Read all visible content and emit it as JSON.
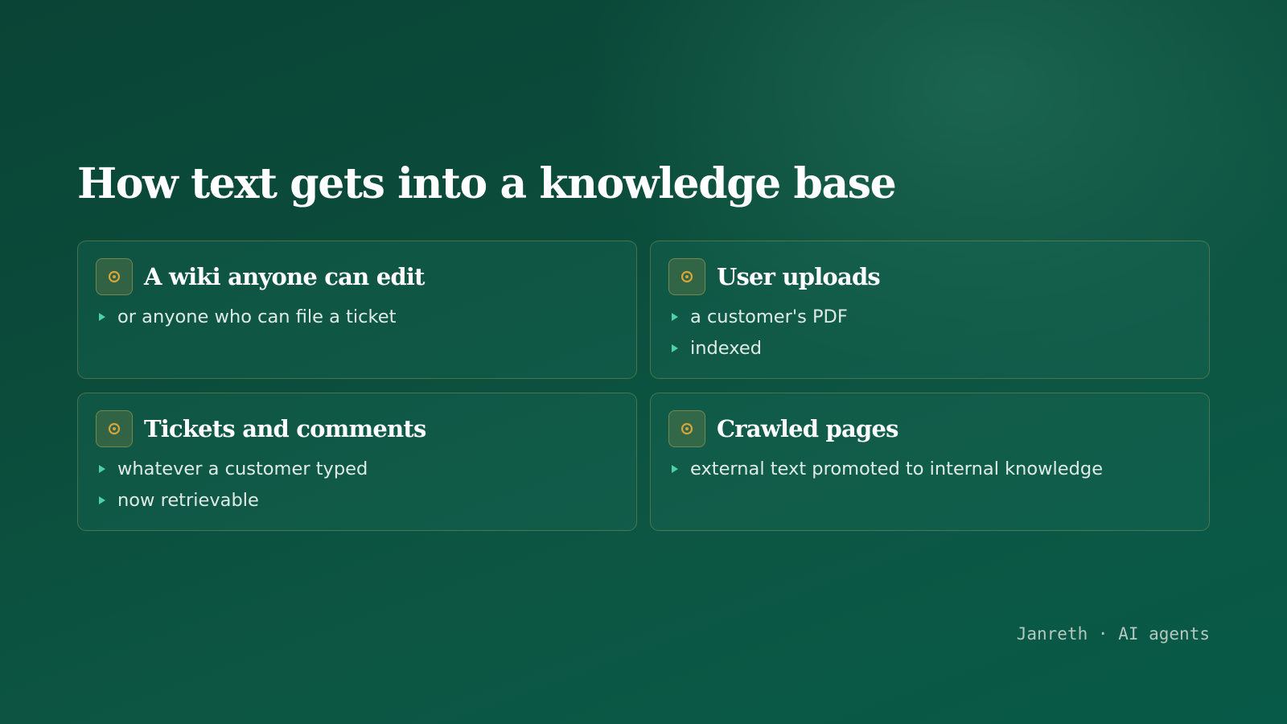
{
  "title": "How text gets into a knowledge base",
  "cards": [
    {
      "title": "A wiki anyone can edit",
      "bullets": [
        "or anyone who can file a ticket"
      ]
    },
    {
      "title": "User uploads",
      "bullets": [
        "a customer's PDF",
        "indexed"
      ]
    },
    {
      "title": "Tickets and comments",
      "bullets": [
        "whatever a customer typed",
        "now retrievable"
      ]
    },
    {
      "title": "Crawled pages",
      "bullets": [
        "external text promoted to internal knowledge"
      ]
    }
  ],
  "footer": {
    "brand": "Janreth",
    "separator": "·",
    "topic": "AI agents"
  },
  "icon": "target-icon",
  "colors": {
    "accent": "#4fd1a5",
    "icon_ring": "#d4a63a",
    "card_border": "#8a8a4a"
  }
}
